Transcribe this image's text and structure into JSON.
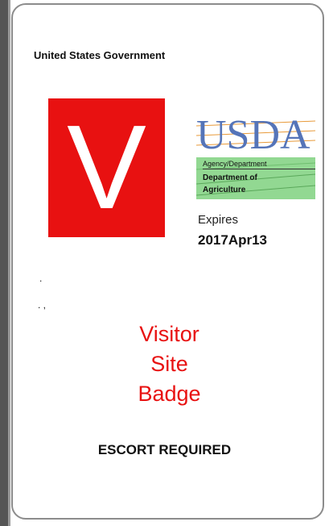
{
  "badge": {
    "government_title": "United States Government",
    "letter": "V",
    "logo": {
      "name": "usda-logo",
      "text": "USDA",
      "agency_label": "Agency/Department",
      "department_line1": "Department of",
      "department_line2": "Agriculture"
    },
    "expires_label": "Expires",
    "expires_date": "2017Apr13",
    "marks": {
      "mark1": ".",
      "mark2": ". ,"
    },
    "visitor_text": [
      "Visitor",
      "Site",
      "Badge"
    ],
    "escort_text": "ESCORT REQUIRED"
  },
  "colors": {
    "accent_red": "#e81111",
    "usda_blue": "#5574b8",
    "usda_green": "#7fd17f"
  }
}
